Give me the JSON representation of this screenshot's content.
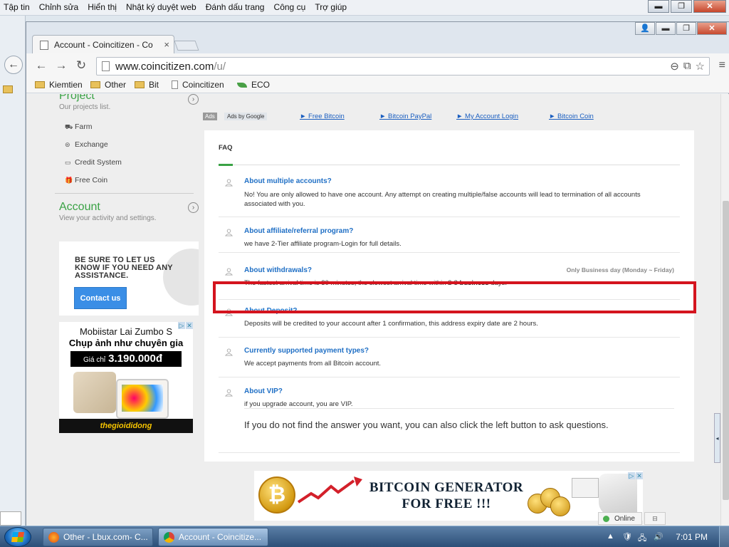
{
  "outer_menu": [
    "Tập tin",
    "Chỉnh sửa",
    "Hiển thị",
    "Nhật ký duyệt web",
    "Đánh dấu trang",
    "Công cụ",
    "Trợ giúp"
  ],
  "chrome": {
    "tab_title": "Account - Coincitizen - Co",
    "url_main": "www.coincitizen.com",
    "url_path": "/u/",
    "bookmarks": [
      "Kiemtien",
      "Other",
      "Bit",
      "Coincitizen",
      "ECO"
    ]
  },
  "sidebar": {
    "project_title": "Project",
    "project_sub": "Our projects list.",
    "items": [
      "Farm",
      "Exchange",
      "Credit System",
      "Free Coin"
    ],
    "account_title": "Account",
    "account_sub": "View your activity and settings."
  },
  "contact": {
    "text": "BE SURE TO LET US KNOW IF YOU NEED ANY ASSISTANCE.",
    "button": "Contact us"
  },
  "phone_ad": {
    "line1": "Mobiistar Lai Zumbo S",
    "line2": "Chụp ảnh như chuyên gia",
    "price_label": "Giá chỉ",
    "price": "3.190.000đ",
    "brand": "thegioididong"
  },
  "ads_row": {
    "tag": "Ads",
    "google": "Ads by Google",
    "links": [
      "► Free Bitcoin",
      "► Bitcoin PayPal",
      "► My Account Login",
      "► Bitcoin Coin"
    ]
  },
  "faq": {
    "tab": "FAQ",
    "items": [
      {
        "q": "About multiple accounts?",
        "a": "No! You are only allowed to have one account. Any attempt on creating multiple/false accounts will lead to termination of all accounts associated with you."
      },
      {
        "q": "About affiliate/referral program?",
        "a": "we have 2-Tier affiliate program-Login for full details."
      },
      {
        "q": "About withdrawals?",
        "a_pre": "The fastest arrival time is 30 minutes, the slowest arrival time within 2-3 ",
        "a_bold": "business",
        "a_post": " days.",
        "note": "Only Business day (Monday ~ Friday)"
      },
      {
        "q": "About Deposit?",
        "a": "Deposits will be credited to your account after 1 confirmation, this address expiry date are 2 hours."
      },
      {
        "q": "Currently supported payment types?",
        "a": "We accept payments from all Bitcoin account."
      },
      {
        "q": "About VIP?",
        "a": "if you upgrade account, you are VIP."
      }
    ],
    "footer": "If you do not find the answer you want, you can also click the left button to ask questions."
  },
  "btc_ad": {
    "line1": "BITCOIN GENERATOR",
    "line2": "FOR FREE !!!"
  },
  "online_label": "Online",
  "taskbar": {
    "tasks": [
      "Other - Lbux.com- C...",
      "Account - Coincitize..."
    ],
    "clock": "7:01 PM"
  },
  "colors": {
    "accent_green": "#3aa245",
    "link_blue": "#1f6fc5",
    "highlight_red": "#d4141e"
  }
}
